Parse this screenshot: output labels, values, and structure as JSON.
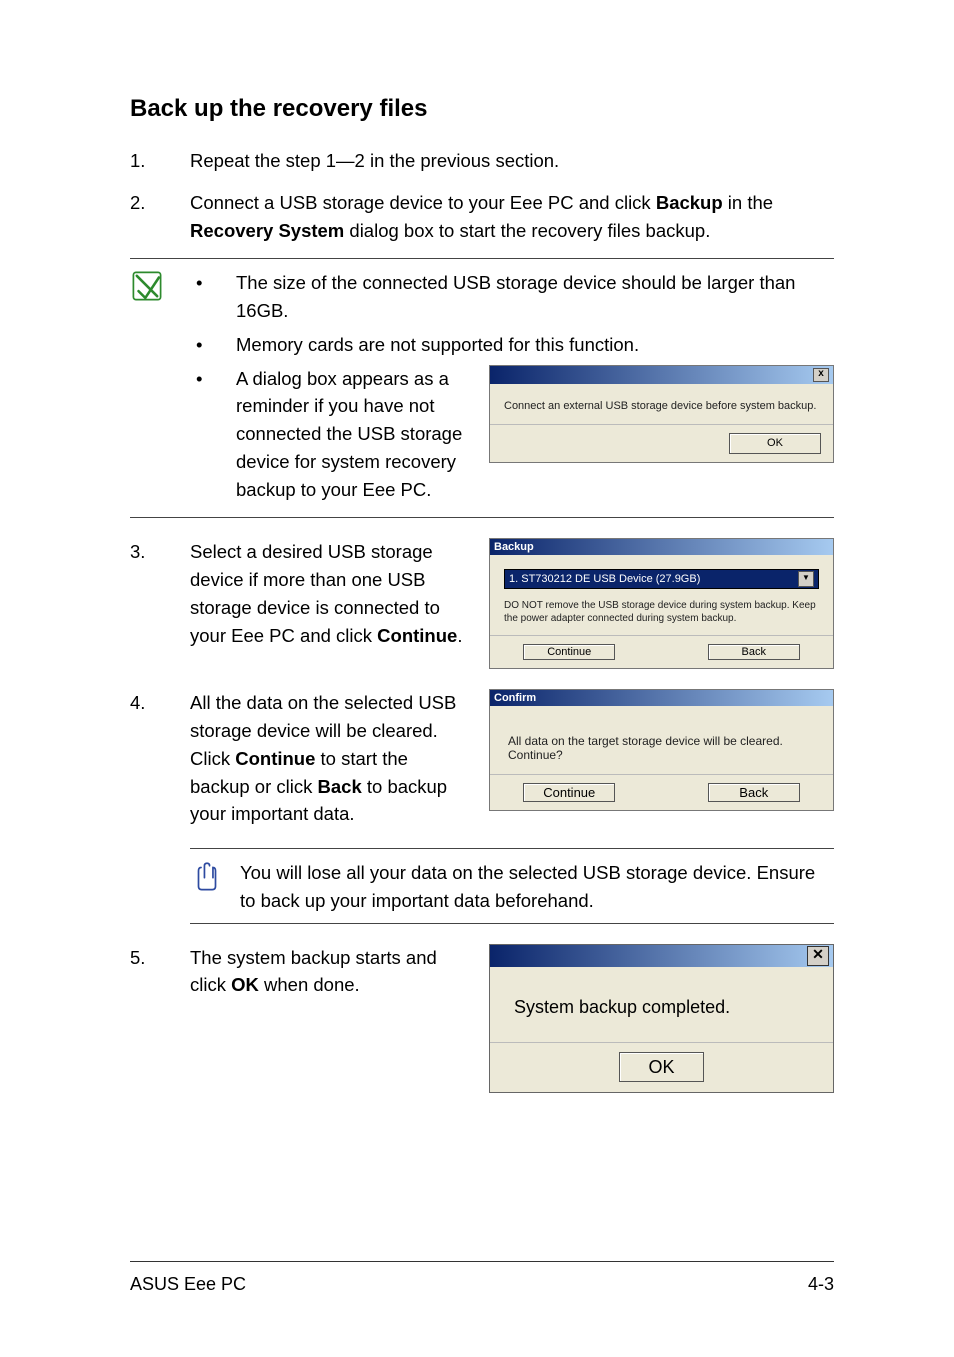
{
  "heading": "Back up the recovery files",
  "step1": {
    "num": "1.",
    "text": "Repeat the step 1—2 in the previous section."
  },
  "step2": {
    "num": "2.",
    "pre": "Connect a USB storage device to your Eee PC and click ",
    "bold1": "Backup",
    "mid": " in the ",
    "bold2": "Recovery System",
    "post": " dialog box to start the recovery files backup."
  },
  "noteA": {
    "b1": "The size of the connected USB storage device should be larger than 16GB.",
    "b2": "Memory cards are not supported for this function.",
    "b3": "A dialog box appears as a reminder if you have not connected the USB storage device for system recovery backup to your Eee PC."
  },
  "dlg_connect": {
    "msg": "Connect an external USB storage device before system backup.",
    "ok": "OK"
  },
  "step3": {
    "num": "3.",
    "pre": "Select a desired USB storage device if more than one USB storage device is connected to your Eee PC and click ",
    "bold1": "Continue",
    "post": "."
  },
  "dlg_backup": {
    "title": "Backup",
    "device": "1. ST730212 DE USB Device  (27.9GB)",
    "warn": "DO NOT remove the USB storage device during system backup. Keep the power adapter connected during system backup.",
    "continue": "Continue",
    "back": "Back"
  },
  "step4": {
    "num": "4.",
    "pre": "All the data on the selected USB storage device will be cleared. Click ",
    "bold1": "Continue",
    "mid": " to start the backup or click ",
    "bold2": "Back",
    "post": " to backup your important data."
  },
  "dlg_confirm": {
    "title": "Confirm",
    "msg": "All data on the target storage device will be cleared. Continue?",
    "continue": "Continue",
    "back": "Back"
  },
  "noteB": "You will lose all your data on the selected USB storage device. Ensure to back up your important data beforehand.",
  "step5": {
    "num": "5.",
    "pre": "The system backup starts and click ",
    "bold1": "OK",
    "post": " when done."
  },
  "dlg_done": {
    "msg": "System backup completed.",
    "ok": "OK"
  },
  "footer": {
    "left": "ASUS Eee PC",
    "right": "4-3"
  }
}
